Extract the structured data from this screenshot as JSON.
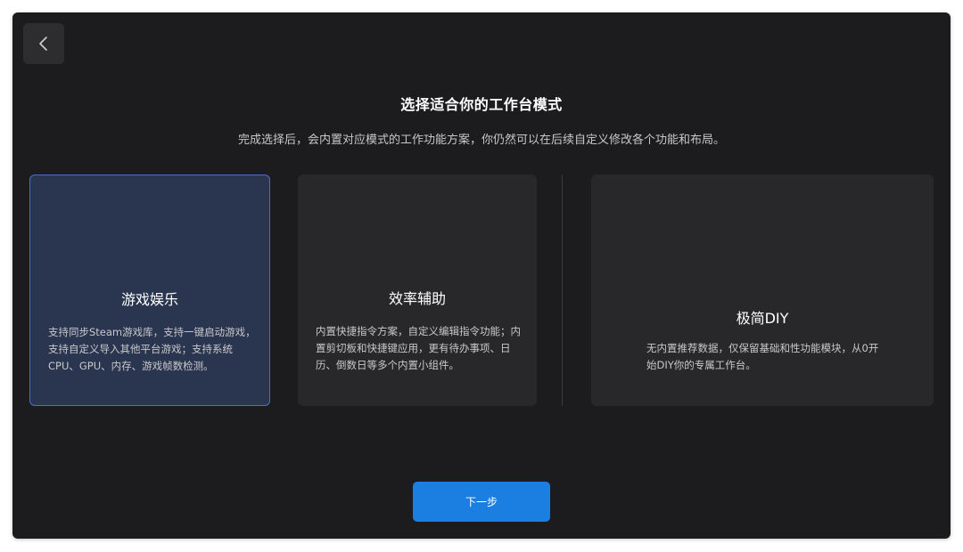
{
  "header": {
    "back_icon": "chevron-left-icon",
    "title": "选择适合你的工作台模式",
    "subtitle": "完成选择后，会内置对应模式的工作功能方案，你仍然可以在后续自定义修改各个功能和布局。"
  },
  "modes": [
    {
      "title": "游戏娱乐",
      "description": "支持同步Steam游戏库，支持一键启动游戏，支持自定义导入其他平台游戏；支持系统CPU、GPU、内存、游戏帧数检测。",
      "selected": true
    },
    {
      "title": "效率辅助",
      "description": "内置快捷指令方案，自定义编辑指令功能；内置剪切板和快捷键应用，更有待办事项、日历、倒数日等多个内置小组件。",
      "selected": false
    },
    {
      "title": "极简DIY",
      "description": "无内置推荐数据，仅保留基础和性功能模块，从0开始DIY你的专属工作台。",
      "selected": false
    }
  ],
  "footer": {
    "next_label": "下一步"
  },
  "colors": {
    "window_bg": "#1c1c1e",
    "card_bg": "#28282b",
    "selected_card_bg": "#2a3550",
    "selected_border": "#4b6fd0",
    "primary_button": "#1a7fe0"
  }
}
